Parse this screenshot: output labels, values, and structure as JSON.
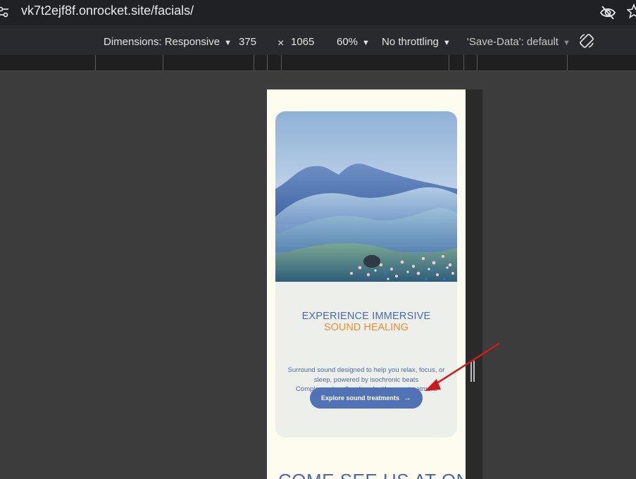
{
  "browser": {
    "url": "vk7t2ejf8f.onrocket.site/facials/"
  },
  "devtools": {
    "dimensions_label": "Dimensions: Responsive",
    "width": "375",
    "times": "×",
    "height": "1065",
    "zoom": "60%",
    "throttling": "No throttling",
    "save_data": "'Save-Data': default"
  },
  "page": {
    "card": {
      "title_line1": "EXPERIENCE IMMERSIVE",
      "title_line2": "SOUND HEALING",
      "desc_line1": "Surround sound designed to help you relax, focus, or",
      "desc_line2": "sleep, powered by isochronic beats",
      "desc_line3": "Complementary & optional with every treatment",
      "cta_label": "Explore sound treatments",
      "cta_arrow": "→"
    },
    "next_heading": "COME SEE US AT ONE"
  },
  "colors": {
    "accent_blue": "#4a68ad",
    "accent_orange": "#e98c33",
    "button_blue": "#5172b5",
    "annotation_red": "#d0191c"
  }
}
